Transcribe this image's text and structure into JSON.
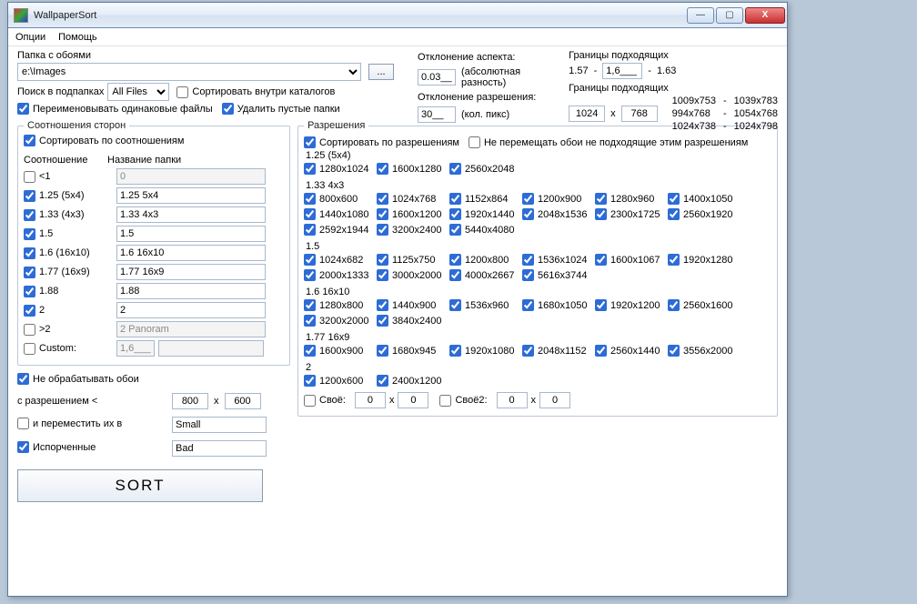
{
  "window": {
    "title": "WallpaperSort",
    "min": "—",
    "max": "▢",
    "close": "X"
  },
  "menu": {
    "options": "Опции",
    "help": "Помощь"
  },
  "folder": {
    "label": "Папка с обоями",
    "value": "e:\\Images",
    "browse": "..."
  },
  "search": {
    "label": "Поиск в подпапках",
    "allfiles": "All Files",
    "sortinside": "Сортировать внутри каталогов",
    "rename": "Переименовывать одинаковые файлы",
    "delempty": "Удалить пустые папки"
  },
  "aspect": {
    "devlabel": "Отклонение аспекта:",
    "devval": "0.03__",
    "devnote": "(абсолютная разность)",
    "reslabel": "Отклонение разрешения:",
    "resval": "30__",
    "resnote": "(кол. пикс)"
  },
  "bounds": {
    "title": "Границы подходящих",
    "a": "1.57",
    "dash1": "-",
    "b": "1,6___",
    "dash2": "-",
    "c": "1.63",
    "title2": "Границы подходящих",
    "w": "1024",
    "x": "x",
    "h": "768",
    "list": [
      "1009x753",
      "-",
      "1039x783",
      "994x768",
      "-",
      "1054x768",
      "1024x738",
      "-",
      "1024x798"
    ]
  },
  "ratios": {
    "fs": "Соотношения сторон",
    "sortchk": "Сортировать по соотношениям",
    "colratio": "Соотношение",
    "colname": "Название папки",
    "items": [
      {
        "chk": false,
        "label": "<1",
        "val": "0",
        "dim": true
      },
      {
        "chk": true,
        "label": "1.25 (5x4)",
        "val": "1.25 5x4"
      },
      {
        "chk": true,
        "label": "1.33 (4x3)",
        "val": "1.33 4x3"
      },
      {
        "chk": true,
        "label": "1.5",
        "val": "1.5"
      },
      {
        "chk": true,
        "label": "1.6 (16x10)",
        "val": "1.6 16x10"
      },
      {
        "chk": true,
        "label": "1.77 (16x9)",
        "val": "1.77 16x9"
      },
      {
        "chk": true,
        "label": "1.88",
        "val": "1.88"
      },
      {
        "chk": true,
        "label": "2",
        "val": "2"
      },
      {
        "chk": false,
        "label": ">2",
        "val": "2 Panoram",
        "dim": true
      },
      {
        "chk": false,
        "label": "Custom:",
        "val": "1,6___",
        "extra": ""
      }
    ]
  },
  "small": {
    "noproc": "Не обрабатывать обои",
    "reslabel": "с разрешением <",
    "w": "800",
    "x": "x",
    "h": "600",
    "move": "и переместить их в",
    "movedir": "Small",
    "broken": "Испорченные",
    "brokendir": "Bad"
  },
  "sort": "SORT",
  "res": {
    "fs": "Разрешения",
    "sortchk": "Сортировать по разрешениям",
    "nomove": "Не перемещать обои не подходящие этим разрешениям",
    "groups": [
      {
        "name": "1.25 (5x4)",
        "items": [
          "1280x1024",
          "1600x1280",
          "2560x2048"
        ]
      },
      {
        "name": "1.33 4x3",
        "items": [
          "800x600",
          "1024x768",
          "1152x864",
          "1200x900",
          "1280x960",
          "1400x1050",
          "1440x1080",
          "1600x1200",
          "1920x1440",
          "2048x1536",
          "2300x1725",
          "2560x1920",
          "2592x1944",
          "3200x2400",
          "5440x4080"
        ]
      },
      {
        "name": "1.5",
        "items": [
          "1024x682",
          "1125x750",
          "1200x800",
          "1536x1024",
          "1600x1067",
          "1920x1280",
          "2000x1333",
          "3000x2000",
          "4000x2667",
          "5616x3744"
        ]
      },
      {
        "name": "1.6 16x10",
        "items": [
          "1280x800",
          "1440x900",
          "1536x960",
          "1680x1050",
          "1920x1200",
          "2560x1600",
          "3200x2000",
          "3840x2400"
        ]
      },
      {
        "name": "1.77 16x9",
        "items": [
          "1600x900",
          "1680x945",
          "1920x1080",
          "2048x1152",
          "2560x1440",
          "3556x2000"
        ]
      },
      {
        "name": "2",
        "items": [
          "1200x600",
          "2400x1200"
        ]
      }
    ],
    "own1": "Своё:",
    "o1a": "0",
    "o1x": "x",
    "o1b": "0",
    "own2": "Своё2:",
    "o2a": "0",
    "o2x": "x",
    "o2b": "0"
  }
}
